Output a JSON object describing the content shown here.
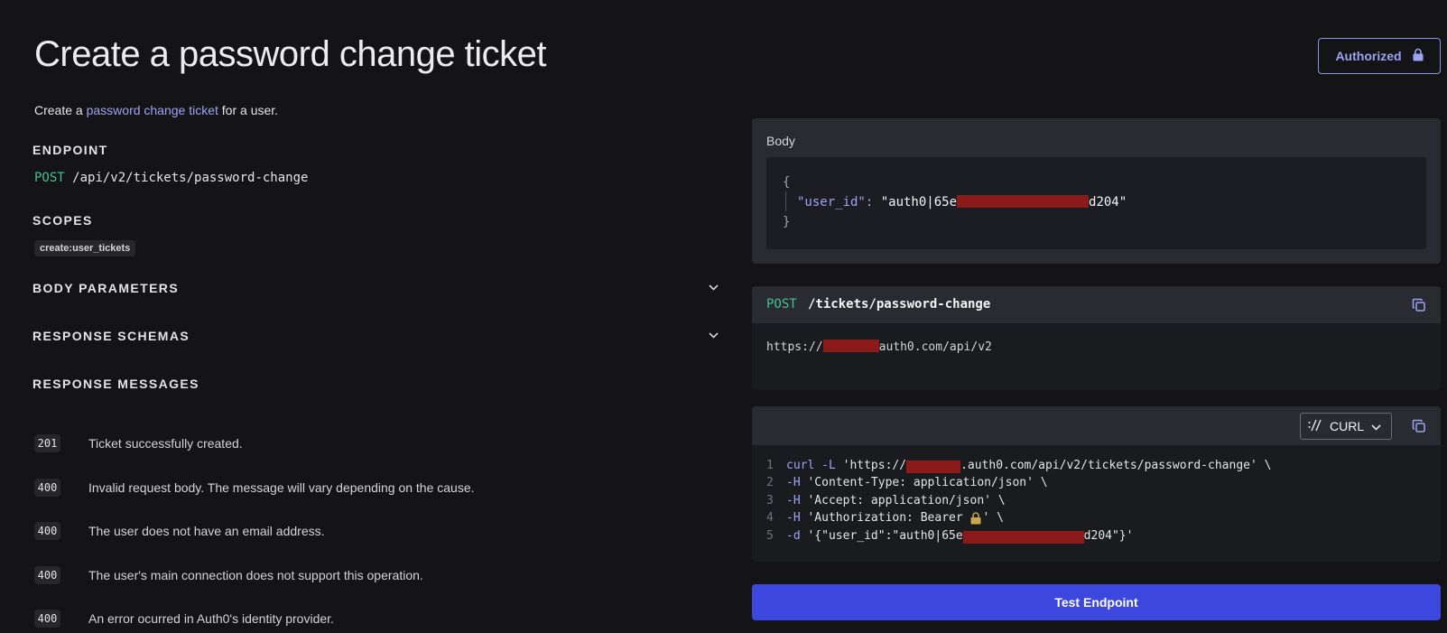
{
  "header": {
    "title": "Create a password change ticket",
    "description_prefix": "Create a ",
    "description_link": "password change ticket",
    "description_suffix": " for a user.",
    "authorized_label": "Authorized"
  },
  "endpoint": {
    "label": "ENDPOINT",
    "method": "POST",
    "path": "/api/v2/tickets/password-change"
  },
  "scopes": {
    "label": "SCOPES",
    "items": [
      "create:user_tickets"
    ]
  },
  "sections": {
    "body_parameters": "BODY PARAMETERS",
    "response_schemas": "RESPONSE SCHEMAS",
    "response_messages": "RESPONSE MESSAGES"
  },
  "responses": [
    {
      "code": "201",
      "text": "Ticket successfully created."
    },
    {
      "code": "400",
      "text": "Invalid request body. The message will vary depending on the cause."
    },
    {
      "code": "400",
      "text": "The user does not have an email address."
    },
    {
      "code": "400",
      "text": "The user's main connection does not support this operation."
    },
    {
      "code": "400",
      "text": "An error ocurred in Auth0's identity provider."
    }
  ],
  "body_panel": {
    "label": "Body",
    "open_brace": "{",
    "close_brace": "}",
    "key": "\"user_id\"",
    "colon": ": ",
    "value_prefix": "\"auth0|65e",
    "value_suffix": "d204\""
  },
  "request_panel": {
    "method": "POST",
    "path": "/tickets/password-change",
    "url_prefix": "https://",
    "url_suffix": "auth0.com/api/v2"
  },
  "curl_panel": {
    "language": "CURL",
    "lines": [
      {
        "num": "1",
        "kw": "curl",
        "flag": " -L ",
        "text_a": "'https://",
        "text_b": ".auth0.com/api/v2/tickets/password-change' \\"
      },
      {
        "num": "2",
        "flag": "-H ",
        "text": "'Content-Type: application/json' \\"
      },
      {
        "num": "3",
        "flag": "-H ",
        "text": "'Accept: application/json' \\"
      },
      {
        "num": "4",
        "flag": "-H ",
        "text": "'Authorization: Bearer ",
        "text_end": "' \\"
      },
      {
        "num": "5",
        "flag": "-d ",
        "text_a": "'{\"user_id\":\"auth0|65e",
        "text_b": "d204\"}'"
      }
    ]
  },
  "actions": {
    "test_endpoint": "Test Endpoint"
  },
  "colors": {
    "accent": "#3c47de",
    "link": "#9ba3f5",
    "method_green": "#3ec28f",
    "redaction": "#8b1a1a"
  }
}
